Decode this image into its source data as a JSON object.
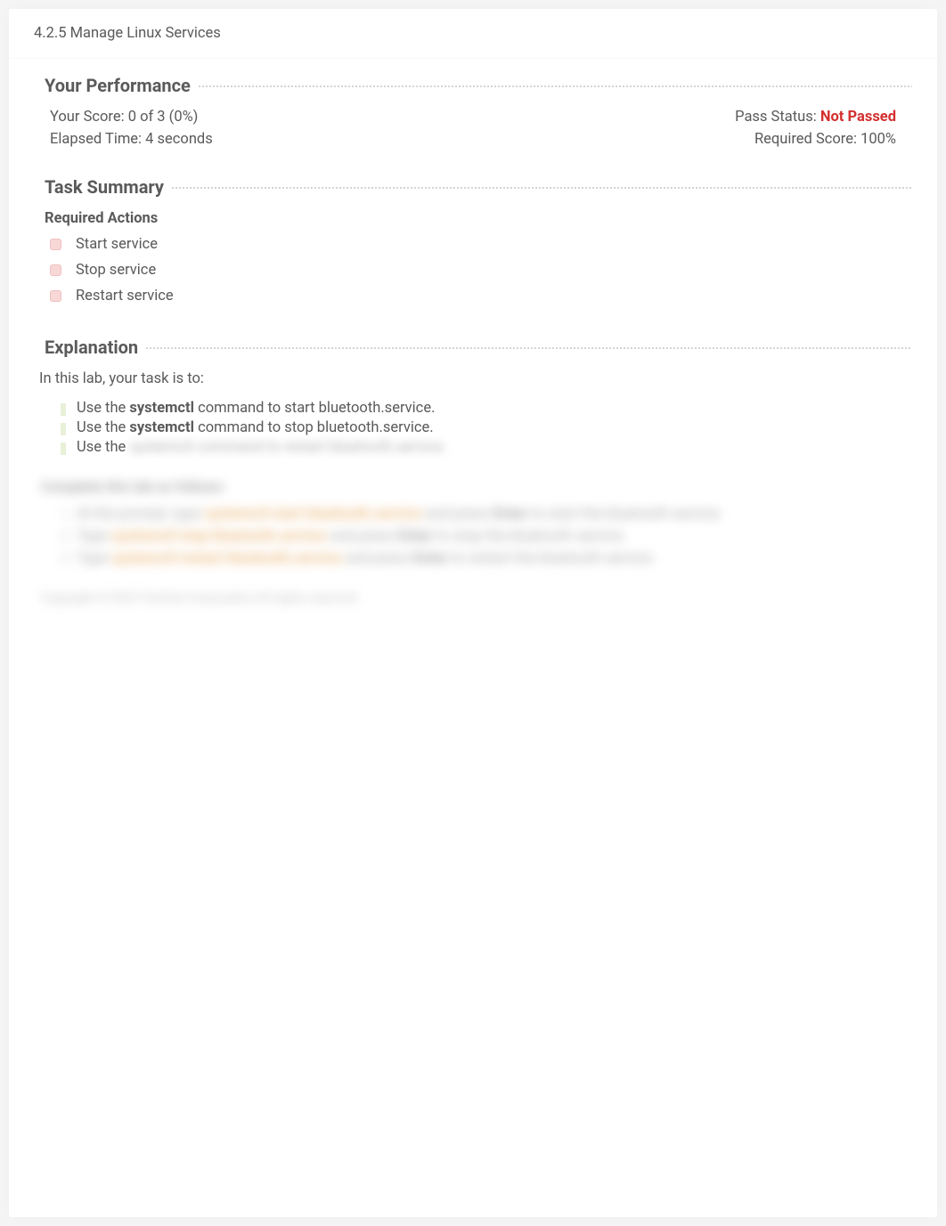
{
  "page_title": "4.2.5 Manage Linux Services",
  "performance": {
    "heading": "Your Performance",
    "score_label": "Your Score:",
    "score_value": "0 of 3 (0%)",
    "pass_label": "Pass Status:",
    "pass_value": "Not Passed",
    "elapsed_label": "Elapsed Time:",
    "elapsed_value": "4 seconds",
    "required_label": "Required Score:",
    "required_value": "100%"
  },
  "task_summary": {
    "heading": "Task Summary",
    "required_actions_label": "Required Actions",
    "actions": [
      "Start service",
      "Stop service",
      "Restart service"
    ]
  },
  "explanation": {
    "heading": "Explanation",
    "intro": "In this lab, your task is to:",
    "bullets": [
      {
        "pre": "Use the ",
        "bold": "systemctl",
        "post": " command to start bluetooth.service."
      },
      {
        "pre": "Use the ",
        "bold": "systemctl",
        "post": " command to stop bluetooth.service."
      },
      {
        "pre": "Use the ",
        "bold": "",
        "post": ""
      }
    ],
    "blurred": {
      "trail": "systemctl   command to restart bluetooth.service.",
      "sub_heading": "Complete this lab as follows:",
      "steps": [
        {
          "n": "1.",
          "a": "At the prompt, type ",
          "b": "systemctl start bluetooth.service",
          "c": " and press ",
          "d": "Enter",
          "e": " to start the bluetooth service."
        },
        {
          "n": "2.",
          "a": "Type ",
          "b": "systemctl stop bluetooth.service",
          "c": " and press ",
          "d": "Enter",
          "e": " to stop the bluetooth service."
        },
        {
          "n": "3.",
          "a": "Type ",
          "b": "systemctl restart bluetooth.service",
          "c": " and press ",
          "d": "Enter",
          "e": " to restart the bluetooth service."
        }
      ],
      "copyright": "Copyright © 2022 TestOut Corporation All rights reserved."
    }
  }
}
